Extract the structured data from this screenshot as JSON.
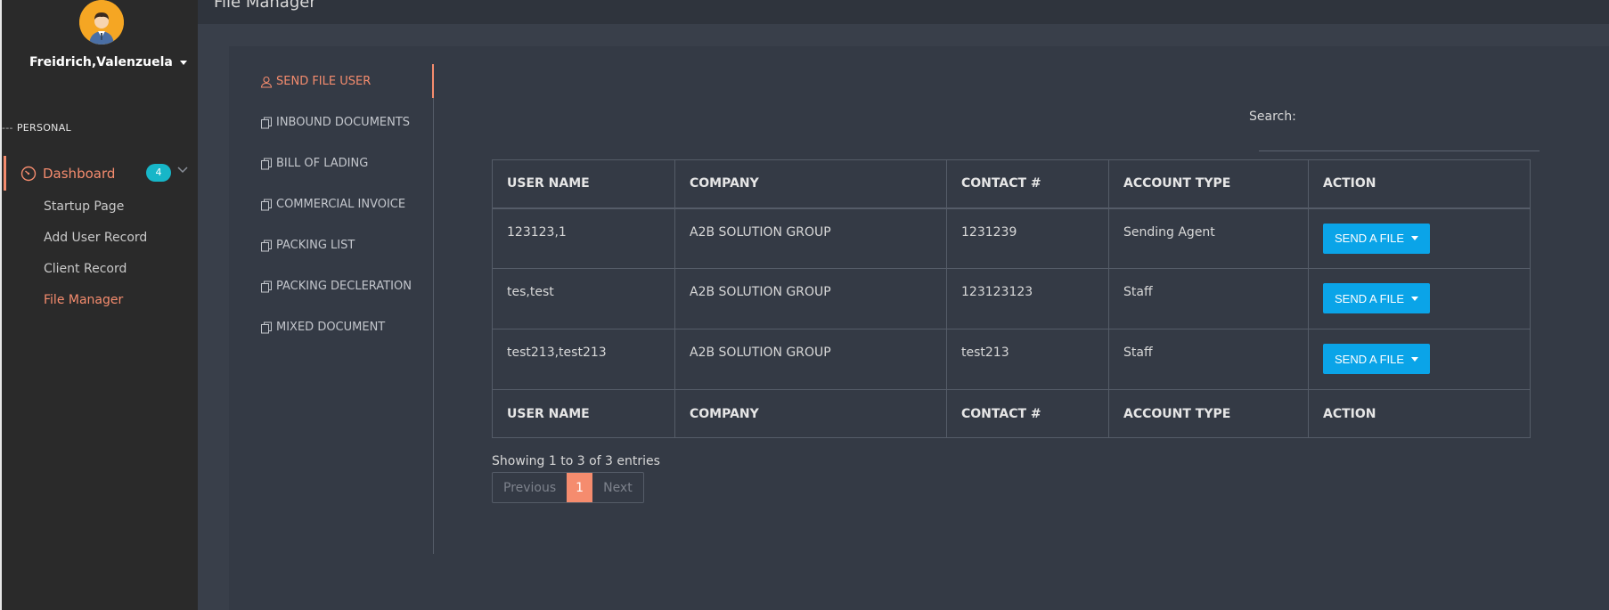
{
  "sidebar": {
    "user_name": "Freidrich,Valenzuela",
    "section_label": "PERSONAL",
    "dashboard": {
      "label": "Dashboard",
      "badge": "4"
    },
    "items": [
      {
        "label": "Startup Page"
      },
      {
        "label": "Add User Record"
      },
      {
        "label": "Client Record"
      },
      {
        "label": "File Manager",
        "active": true
      }
    ]
  },
  "header": {
    "title": "File Manager"
  },
  "tabs": [
    {
      "label": "SEND FILE USER",
      "icon": "user-icon",
      "active": true
    },
    {
      "label": "INBOUND DOCUMENTS",
      "icon": "copy-icon"
    },
    {
      "label": "BILL OF LADING",
      "icon": "copy-icon"
    },
    {
      "label": "COMMERCIAL INVOICE",
      "icon": "copy-icon"
    },
    {
      "label": "PACKING LIST",
      "icon": "copy-icon"
    },
    {
      "label": "PACKING DECLERATION",
      "icon": "copy-icon"
    },
    {
      "label": "MIXED DOCUMENT",
      "icon": "copy-icon"
    }
  ],
  "search": {
    "label": "Search:",
    "value": ""
  },
  "table": {
    "columns": [
      "USER NAME",
      "COMPANY",
      "CONTACT #",
      "ACCOUNT TYPE",
      "ACTION"
    ],
    "rows": [
      {
        "user": "123123,1",
        "company": "A2B SOLUTION GROUP",
        "contact": "1231239",
        "type": "Sending Agent",
        "action": "SEND A FILE"
      },
      {
        "user": "tes,test",
        "company": "A2B SOLUTION GROUP",
        "contact": "123123123",
        "type": "Staff",
        "action": "SEND A FILE"
      },
      {
        "user": "test213,test213",
        "company": "A2B SOLUTION GROUP",
        "contact": "test213",
        "type": "Staff",
        "action": "SEND A FILE"
      }
    ]
  },
  "pagination": {
    "info": "Showing 1 to 3 of 3 entries",
    "previous": "Previous",
    "current": "1",
    "next": "Next"
  },
  "colors": {
    "accent": "#f58c6e",
    "button": "#0aa4e8",
    "badge": "#17b6c8",
    "sidebar": "#2a2a2a",
    "background": "#393f4a"
  }
}
